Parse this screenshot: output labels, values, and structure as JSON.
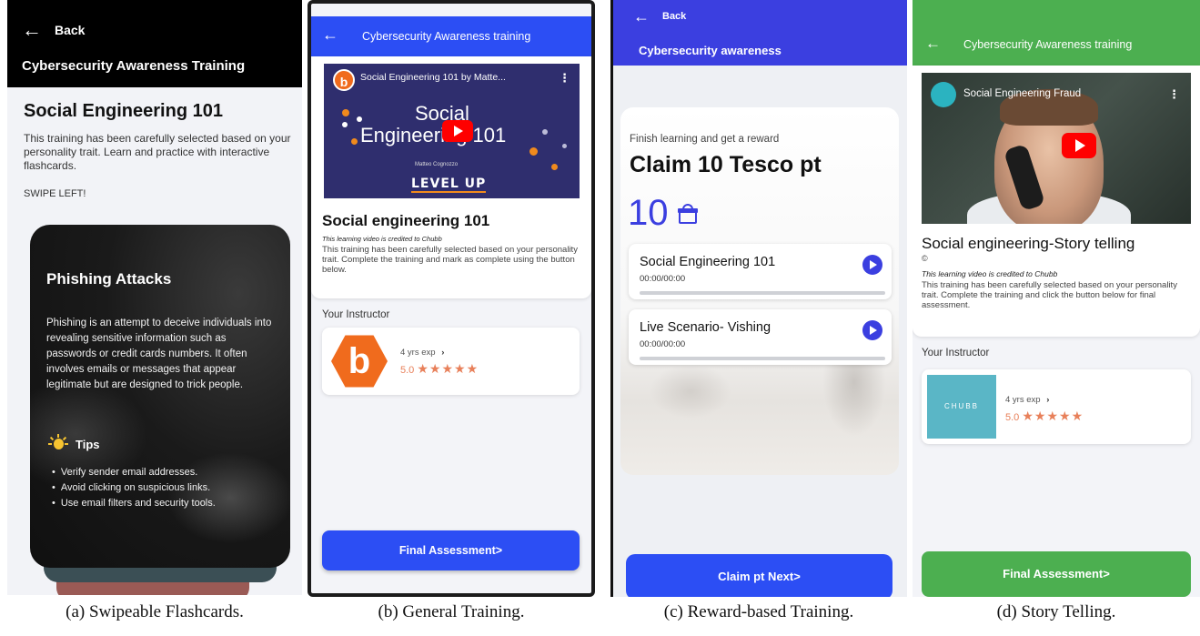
{
  "panel_a": {
    "back_label": "Back",
    "app_title": "Cybersecurity Awareness Training",
    "heading": "Social Engineering 101",
    "description": "This training has been carefully selected based on your personality trait. Learn and practice with interactive flashcards.",
    "swipe_hint": "SWIPE LEFT!",
    "card": {
      "title": "Phishing Attacks",
      "body": "Phishing is an attempt to deceive individuals into revealing sensitive information such as passwords or credit cards numbers. It often involves emails or messages that appear legitimate but are designed to trick people.",
      "tips_label": "Tips",
      "tips": [
        "Verify sender email addresses.",
        "Avoid clicking on suspicious links.",
        "Use email filters and security tools."
      ]
    },
    "caption": "(a) Swipeable Flashcards."
  },
  "panel_b": {
    "app_title": "Cybersecurity Awareness training",
    "video": {
      "title": "Social Engineering 101 by Matte...",
      "overlay_line1": "Social",
      "overlay_line2": "Engineering 101",
      "author": "Matteo Cognozzo",
      "brand": "LEVEL UP"
    },
    "heading": "Social engineering 101",
    "credit": "This learning video is credited to Chubb",
    "description": "This training has been carefully selected based on your personality trait. Complete the training and mark as complete using the button below.",
    "instructor_label": "Your Instructor",
    "instructor": {
      "experience": "4 yrs exp",
      "rating": "5.0",
      "stars": "★★★★★"
    },
    "button": "Final Assessment>",
    "caption": "(b) General Training.",
    "accent_color": "#2c4ef4"
  },
  "panel_c": {
    "back_label": "Back",
    "app_title": "Cybersecurity awareness",
    "subtitle": "Finish learning and get a reward",
    "claim_title": "Claim 10 Tesco pt",
    "points": "10",
    "modules": [
      {
        "title": "Social Engineering 101",
        "time": "00:00/00:00"
      },
      {
        "title": "Live Scenario- Vishing",
        "time": "00:00/00:00"
      }
    ],
    "button": "Claim pt Next>",
    "caption": "(c) Reward-based Training.",
    "accent_color": "#3b3fe0"
  },
  "panel_d": {
    "app_title": "Cybersecurity Awareness training",
    "video": {
      "title": "Social Engineering Fraud"
    },
    "heading": "Social engineering-Story telling",
    "copyright": "©",
    "credit": "This learning video is credited to Chubb",
    "description": "This training has been carefully selected based on your personality trait. Complete the training and click the button below for final assessment.",
    "instructor_label": "Your Instructor",
    "instructor": {
      "logo_text": "CHUBB",
      "experience": "4 yrs exp",
      "rating": "5.0",
      "stars": "★★★★★"
    },
    "button": "Final Assessment>",
    "caption": "(d) Story Telling.",
    "accent_color": "#4caf50"
  }
}
